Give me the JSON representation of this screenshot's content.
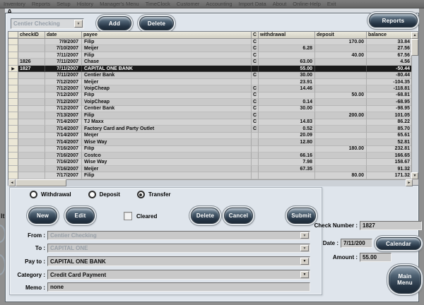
{
  "colors": {
    "menubar_bg": "#6f6f6f",
    "window_bg": "#dfe5ec",
    "button_navy": "#263545",
    "selected_row": "#191919",
    "selector_beige": "#ebe7d6"
  },
  "icons": {
    "up": "▲",
    "down": "▼",
    "left": "◄",
    "right": "►",
    "dropdown": "▼",
    "row_pointer": "▶"
  },
  "menu_bar": {
    "items": [
      "Inventory",
      "Reports",
      "Setup",
      "History",
      "Manager's Menu",
      "TimeClock",
      "Customer",
      "Accounting",
      "Import Data",
      "About",
      "Online-Help",
      "Exit"
    ]
  },
  "background_fragments": {
    "title_fragment": "A",
    "left_fragment": "It"
  },
  "account_bar": {
    "account_select": "Centier Checking",
    "add_label": "Add",
    "delete_label": "Delete",
    "reports_label": "Reports"
  },
  "table": {
    "columns": [
      "checkID",
      "date",
      "payee",
      "C",
      "withdrawal",
      "deposit",
      "balance"
    ],
    "rows": [
      {
        "check_id": "",
        "date": "7/9/2007",
        "payee": "Filip",
        "c": "C",
        "withdrawal": "",
        "deposit": "170.00",
        "balance": "33.84",
        "selected": false
      },
      {
        "check_id": "",
        "date": "7/10/2007",
        "payee": "Meijer",
        "c": "C",
        "withdrawal": "6.28",
        "deposit": "",
        "balance": "27.56",
        "selected": false
      },
      {
        "check_id": "",
        "date": "7/11/2007",
        "payee": "Filip",
        "c": "C",
        "withdrawal": "",
        "deposit": "40.00",
        "balance": "67.56",
        "selected": false
      },
      {
        "check_id": "1826",
        "date": "7/11/2007",
        "payee": "Chase",
        "c": "C",
        "withdrawal": "63.00",
        "deposit": "",
        "balance": "4.56",
        "selected": false
      },
      {
        "check_id": "1827",
        "date": "7/11/2007",
        "payee": "CAPITAL ONE BANK",
        "c": "",
        "withdrawal": "55.00",
        "deposit": "",
        "balance": "-50.44",
        "selected": true
      },
      {
        "check_id": "",
        "date": "7/11/2007",
        "payee": "Centier Bank",
        "c": "C",
        "withdrawal": "30.00",
        "deposit": "",
        "balance": "-80.44",
        "selected": false
      },
      {
        "check_id": "",
        "date": "7/12/2007",
        "payee": "Meijer",
        "c": "",
        "withdrawal": "23.91",
        "deposit": "",
        "balance": "-104.35",
        "selected": false
      },
      {
        "check_id": "",
        "date": "7/12/2007",
        "payee": "VoipCheap",
        "c": "C",
        "withdrawal": "14.46",
        "deposit": "",
        "balance": "-118.81",
        "selected": false
      },
      {
        "check_id": "",
        "date": "7/12/2007",
        "payee": "Filip",
        "c": "C",
        "withdrawal": "",
        "deposit": "50.00",
        "balance": "-68.81",
        "selected": false
      },
      {
        "check_id": "",
        "date": "7/12/2007",
        "payee": "VoipCheap",
        "c": "C",
        "withdrawal": "0.14",
        "deposit": "",
        "balance": "-68.95",
        "selected": false
      },
      {
        "check_id": "",
        "date": "7/12/2007",
        "payee": "Centier Bank",
        "c": "C",
        "withdrawal": "30.00",
        "deposit": "",
        "balance": "-98.95",
        "selected": false
      },
      {
        "check_id": "",
        "date": "7/13/2007",
        "payee": "Filip",
        "c": "C",
        "withdrawal": "",
        "deposit": "200.00",
        "balance": "101.05",
        "selected": false
      },
      {
        "check_id": "",
        "date": "7/14/2007",
        "payee": "TJ Maxx",
        "c": "C",
        "withdrawal": "14.83",
        "deposit": "",
        "balance": "86.22",
        "selected": false
      },
      {
        "check_id": "",
        "date": "7/14/2007",
        "payee": "Factory Card and Party Outlet",
        "c": "C",
        "withdrawal": "0.52",
        "deposit": "",
        "balance": "85.70",
        "selected": false
      },
      {
        "check_id": "",
        "date": "7/14/2007",
        "payee": "Meijer",
        "c": "",
        "withdrawal": "20.09",
        "deposit": "",
        "balance": "65.61",
        "selected": false
      },
      {
        "check_id": "",
        "date": "7/14/2007",
        "payee": "Wise Way",
        "c": "",
        "withdrawal": "12.80",
        "deposit": "",
        "balance": "52.81",
        "selected": false
      },
      {
        "check_id": "",
        "date": "7/16/2007",
        "payee": "Filip",
        "c": "",
        "withdrawal": "",
        "deposit": "180.00",
        "balance": "232.81",
        "selected": false
      },
      {
        "check_id": "",
        "date": "7/16/2007",
        "payee": "Costco",
        "c": "",
        "withdrawal": "66.16",
        "deposit": "",
        "balance": "166.65",
        "selected": false
      },
      {
        "check_id": "",
        "date": "7/16/2007",
        "payee": "Wise Way",
        "c": "",
        "withdrawal": "7.98",
        "deposit": "",
        "balance": "158.67",
        "selected": false
      },
      {
        "check_id": "",
        "date": "7/16/2007",
        "payee": "Meijer",
        "c": "",
        "withdrawal": "67.35",
        "deposit": "",
        "balance": "91.32",
        "selected": false
      },
      {
        "check_id": "",
        "date": "7/17/2007",
        "payee": "Filip",
        "c": "",
        "withdrawal": "",
        "deposit": "80.00",
        "balance": "171.32",
        "selected": false
      }
    ]
  },
  "transaction_panel": {
    "radios": [
      {
        "label": "Withdrawal",
        "selected": false
      },
      {
        "label": "Deposit",
        "selected": false
      },
      {
        "label": "Transfer",
        "selected": true
      }
    ],
    "buttons": {
      "new": "New",
      "edit": "Edit",
      "delete": "Delete",
      "cancel": "Cancel",
      "submit": "Submit"
    },
    "cleared": {
      "label": "Cleared",
      "checked": false
    },
    "fields": {
      "from": {
        "label": "From :",
        "value": "Centier Checking"
      },
      "to": {
        "label": "To :",
        "value": "CAPITAL ONE"
      },
      "pay_to": {
        "label": "Pay to :",
        "value": "CAPITAL ONE BANK"
      },
      "category": {
        "label": "Category :",
        "value": "Credit Card Payment"
      },
      "memo": {
        "label": "Memo :",
        "value": "none"
      }
    }
  },
  "right_panel": {
    "check_number": {
      "label": "Check Number :",
      "value": "1827"
    },
    "date": {
      "label": "Date :",
      "value": "7/11/200"
    },
    "calendar_label": "Calendar",
    "amount": {
      "label": "Amount :",
      "value": "55.00"
    },
    "main_menu": {
      "line1": "Main",
      "line2": "Menu"
    }
  }
}
